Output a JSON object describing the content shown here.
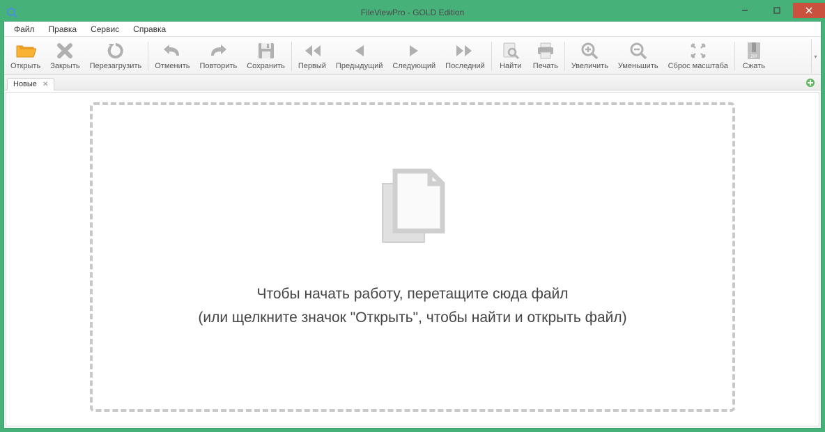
{
  "title": "FileViewPro - GOLD Edition",
  "menu": {
    "file": "Файл",
    "edit": "Правка",
    "service": "Сервис",
    "help": "Справка"
  },
  "toolbar": {
    "open": "Открыть",
    "close": "Закрыть",
    "reload": "Перезагрузить",
    "undo": "Отменить",
    "redo": "Повторить",
    "save": "Сохранить",
    "first": "Первый",
    "prev": "Предыдущий",
    "next": "Следующий",
    "last": "Последний",
    "find": "Найти",
    "print": "Печать",
    "zoom_in": "Увеличить",
    "zoom_out": "Уменьшить",
    "zoom_reset": "Сброс масштаба",
    "compress": "Сжать"
  },
  "tabs": {
    "new": "Новые"
  },
  "dropzone": {
    "line1": "Чтобы начать работу, перетащите сюда файл",
    "line2": "(или щелкните значок \"Открыть\", чтобы найти и открыть файл)"
  }
}
